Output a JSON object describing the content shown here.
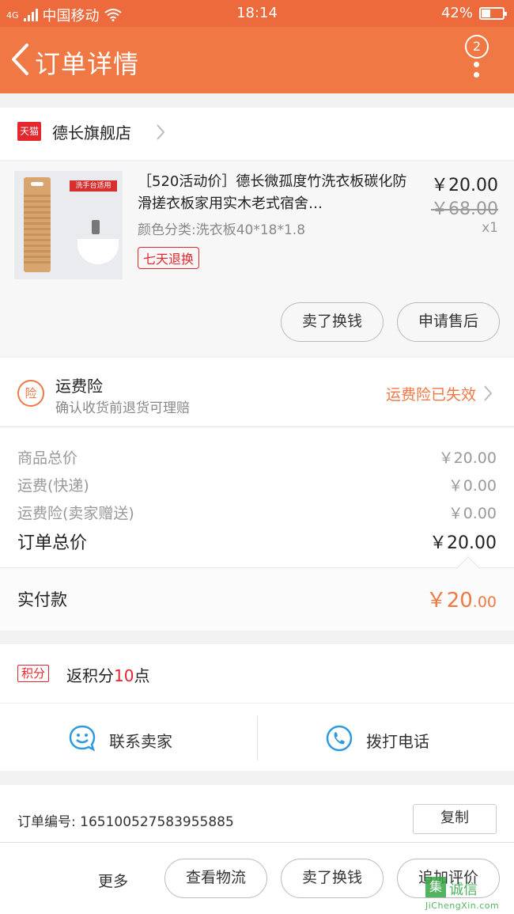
{
  "status_bar": {
    "network": "4G",
    "carrier": "中国移动",
    "time": "18:14",
    "battery": "42%",
    "battery_level": 0.42
  },
  "header": {
    "title": "订单详情",
    "badge_count": "2"
  },
  "store": {
    "platform": "天猫",
    "name": "德长旗舰店"
  },
  "product": {
    "title": "［520活动价］德长微孤度竹洗衣板碳化防滑搓衣板家用实木老式宿舍…",
    "sku": "颜色分类:洗衣板40*18*1.8",
    "tag": "七天退换",
    "price": "￥20.00",
    "original_price": "￥68.00",
    "quantity": "x1",
    "image_tag": "洗手台适用",
    "buttons": {
      "refund": "卖了换钱",
      "after_sales": "申请售后"
    }
  },
  "insurance": {
    "icon_label": "险",
    "title": "运费险",
    "subtitle": "确认收货前退货可理赔",
    "status": "运费险已失效"
  },
  "summary": {
    "rows": [
      {
        "label": "商品总价",
        "value": "￥20.00"
      },
      {
        "label": "运费(快递)",
        "value": "￥0.00"
      },
      {
        "label": "运费险(卖家赠送)",
        "value": "￥0.00"
      }
    ],
    "total_label": "订单总价",
    "total_value": "￥20.00",
    "paid_label": "实付款",
    "paid_int": "￥20",
    "paid_dec": ".00"
  },
  "points": {
    "tag": "积分",
    "text_prefix": "返积分",
    "number": "10",
    "text_suffix": "点"
  },
  "contact": {
    "seller": "联系卖家",
    "phone": "拨打电话"
  },
  "order_info": {
    "order_number": "订单编号: 1651005275839558​85",
    "copy": "复制"
  },
  "bottom_bar": {
    "more": "更多",
    "logistics": "查看物流",
    "sell": "卖了换钱",
    "review": "追加评价"
  },
  "watermark": {
    "char": "集",
    "cn": "诚信",
    "en": "JiChengXin.com"
  },
  "colors": {
    "brand_orange": "#f07844",
    "status_bar": "#ec6a3c",
    "tmall_red": "#e4262d",
    "contact_blue": "#2d9ae0"
  }
}
